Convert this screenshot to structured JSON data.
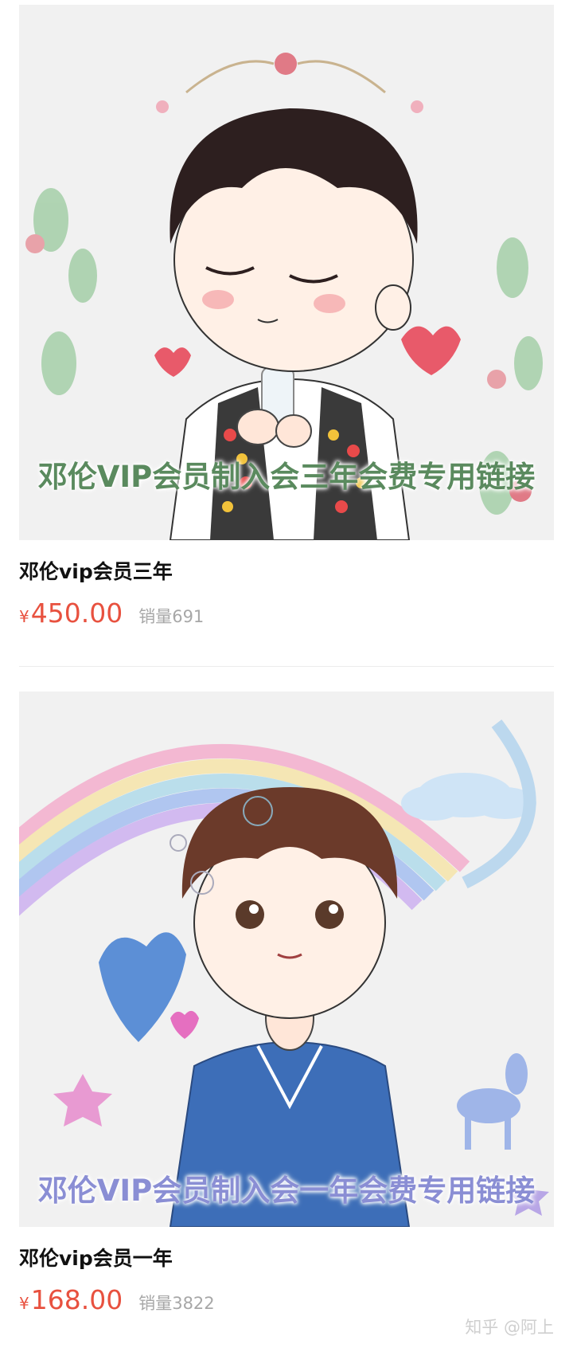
{
  "products": [
    {
      "banner_text": "邓伦VIP会员制入会三年会费专用链接",
      "title": "邓伦vip会员三年",
      "currency": "¥",
      "price": "450.00",
      "sales": "销量691"
    },
    {
      "banner_text": "邓伦VIP会员制入会一年会费专用链接",
      "title": "邓伦vip会员一年",
      "currency": "¥",
      "price": "168.00",
      "sales": "销量3822"
    }
  ],
  "watermark": "知乎 @阿上",
  "colors": {
    "price": "#e8513f",
    "sales": "#a7a7a7",
    "title": "#111111",
    "divider": "#ececec"
  }
}
